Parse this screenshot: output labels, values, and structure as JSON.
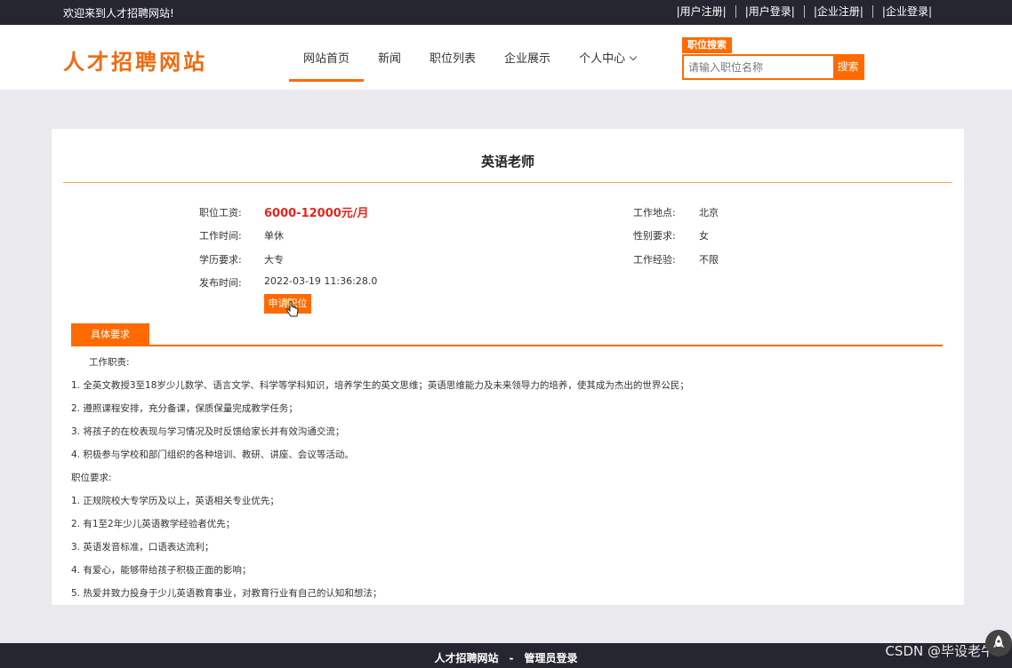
{
  "topbar": {
    "welcome": "欢迎来到人才招聘网站!",
    "links": [
      "|用户注册|",
      "|用户登录|",
      "|企业注册|",
      "|企业登录|"
    ]
  },
  "header": {
    "logo": "人才招聘网站",
    "nav": [
      "网站首页",
      "新闻",
      "职位列表",
      "企业展示",
      "个人中心"
    ],
    "search_tag": "职位搜索",
    "search_placeholder": "请输入职位名称",
    "search_button": "搜索"
  },
  "job": {
    "title": "英语老师",
    "left": [
      {
        "label": "职位工资:",
        "value": "6000-12000元/月"
      },
      {
        "label": "工作时间:",
        "value": "单休"
      },
      {
        "label": "学历要求:",
        "value": "大专"
      },
      {
        "label": "发布时间:",
        "value": "2022-03-19 11:36:28.0"
      }
    ],
    "right": [
      {
        "label": "工作地点:",
        "value": "北京"
      },
      {
        "label": "性别要求:",
        "value": "女"
      },
      {
        "label": "工作经验:",
        "value": "不限"
      }
    ],
    "apply_button": "申请职位",
    "tab_label": "具体要求",
    "requirements": [
      "工作职责:",
      "1. 全英文教授3至18岁少儿数学、语言文学、科学等学科知识，培养学生的英文思维；英语思维能力及未来领导力的培养，使其成为杰出的世界公民；",
      "2. 遵照课程安排，充分备课，保质保量完成教学任务；",
      "3. 将孩子的在校表现与学习情况及时反馈给家长并有效沟通交流；",
      "4. 积极参与学校和部门组织的各种培训、教研、讲座、会议等活动。",
      "职位要求:",
      "1. 正规院校大专学历及以上，英语相关专业优先；",
      "2. 有1至2年少儿英语教学经验者优先；",
      "3. 英语发音标准，口语表达流利；",
      "4. 有爱心，能够带给孩子积极正面的影响；",
      "5. 热爱并致力投身于少儿英语教育事业，对教育行业有自己的认知和想法；"
    ]
  },
  "footer": {
    "site": "人才招聘网站",
    "separator": "-",
    "admin_login": "管理员登录"
  },
  "watermark": "CSDN @毕设老牛",
  "colors": {
    "accent": "#ff6a00",
    "salary": "#e5251c",
    "dark_bar": "#262631"
  }
}
